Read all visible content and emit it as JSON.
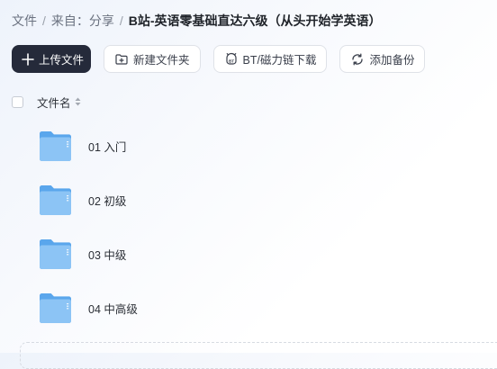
{
  "breadcrumb": {
    "root": "文件",
    "parent": "来自：分享",
    "current": "B站-英语零基础直达六级（从头开始学英语）"
  },
  "toolbar": {
    "upload": "上传文件",
    "new_folder": "新建文件夹",
    "bt": "BT/磁力链下载",
    "backup": "添加备份"
  },
  "list": {
    "column_name": "文件名",
    "items": [
      {
        "name": "01 入门",
        "icon": "folder-icon"
      },
      {
        "name": "02 初级",
        "icon": "folder-icon"
      },
      {
        "name": "03 中级",
        "icon": "folder-icon"
      },
      {
        "name": "04 中高级",
        "icon": "folder-icon"
      }
    ]
  },
  "colors": {
    "primary_button": "#252a3a",
    "folder_light": "#8cc4f5",
    "folder_dark": "#5aa6ec"
  }
}
